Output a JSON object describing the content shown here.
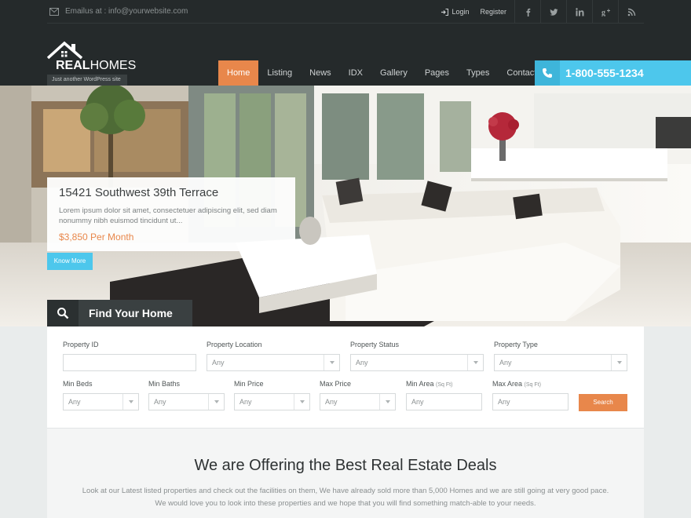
{
  "topbar": {
    "email": "Emailus at : info@yourwebsite.com",
    "login": "Login",
    "register": "Register",
    "social_icons": [
      "facebook-icon",
      "twitter-icon",
      "linkedin-icon",
      "google-plus-icon",
      "rss-icon"
    ]
  },
  "logo": {
    "bold": "REAL",
    "light": "HOMES",
    "tagline": "Just another WordPress site"
  },
  "nav": {
    "items": [
      "Home",
      "Listing",
      "News",
      "IDX",
      "Gallery",
      "Pages",
      "Types",
      "Contact us"
    ],
    "active": "Home"
  },
  "phone": {
    "number": "1-800-555-1234"
  },
  "hero": {
    "title": "15421 Southwest 39th Terrace",
    "description": "Lorem ipsum dolor sit amet, consectetuer adipiscing elit, sed diam nonummy nibh euismod tincidunt ut...",
    "price": "$3,850 Per Month",
    "button": "Know More",
    "find_home": "Find Your Home"
  },
  "search": {
    "property_id": {
      "label": "Property ID",
      "value": ""
    },
    "location": {
      "label": "Property Location",
      "value": "Any"
    },
    "status": {
      "label": "Property Status",
      "value": "Any"
    },
    "type": {
      "label": "Property Type",
      "value": "Any"
    },
    "min_beds": {
      "label": "Min Beds",
      "value": "Any"
    },
    "min_baths": {
      "label": "Min Baths",
      "value": "Any"
    },
    "min_price": {
      "label": "Min Price",
      "value": "Any"
    },
    "max_price": {
      "label": "Max Price",
      "value": "Any"
    },
    "min_area": {
      "label": "Min Area",
      "unit": "(Sq Ft)",
      "placeholder": "Any"
    },
    "max_area": {
      "label": "Max Area",
      "unit": "(Sq Ft)",
      "placeholder": "Any"
    },
    "button": "Search"
  },
  "offering": {
    "title": "We are Offering the Best Real Estate Deals",
    "line1": "Look at our Latest listed properties and check out the facilities on them, We have already sold more than 5,000 Homes and we are still going at very good pace.",
    "line2": "We would love you to look into these properties and we hope that you will find something match-able to your needs."
  },
  "colors": {
    "accent_orange": "#e8874b",
    "accent_blue": "#4dc7ec",
    "header_dark": "#252a2b"
  }
}
